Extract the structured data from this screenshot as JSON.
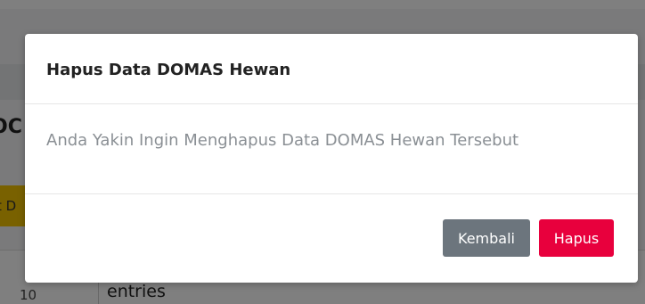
{
  "background": {
    "heading_fragment": "OC",
    "button_fragment": "t D",
    "table": {
      "page_length_value": "10",
      "entries_label": "entries"
    }
  },
  "modal": {
    "title": "Hapus Data DOMAS Hewan",
    "message": "Anda Yakin Ingin Menghapus Data DOMAS Hewan Tersebut",
    "buttons": {
      "back_label": "Kembali",
      "delete_label": "Hapus"
    }
  },
  "colors": {
    "back_button": "#6c757d",
    "delete_button": "#e8003d",
    "background_button": "#f2c200",
    "backdrop": "rgba(0,0,0,0.5)"
  }
}
